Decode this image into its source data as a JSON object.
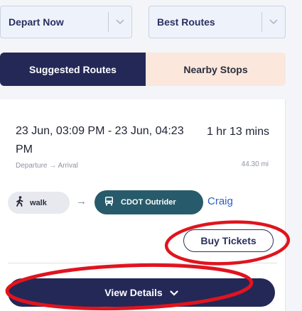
{
  "filters": {
    "departure_select": "Depart Now",
    "route_select": "Best Routes"
  },
  "tabs": [
    {
      "label": "Suggested Routes",
      "active": true
    },
    {
      "label": "Nearby Stops",
      "active": false
    }
  ],
  "route": {
    "time_range": "23 Jun, 03:09 PM - 23 Jun, 04:23 PM",
    "duration": "1 hr 13 mins",
    "dep_arr_label": "Departure → Arrival",
    "distance": "44.30 mi",
    "walk_label": "walk",
    "arrow": "→",
    "bus_label": "CDOT Outrider",
    "bus_link": "Craig",
    "buy_button": "Buy Tickets",
    "details_button": "View Details"
  },
  "colors": {
    "navy": "#232857",
    "teal": "#275b6b",
    "peach": "#fbe7dc",
    "link": "#2f5fc1",
    "annotation_red": "#e0141e"
  },
  "icons": {
    "select_chevron": "chevron-down-icon",
    "walk": "walk-icon",
    "bus": "bus-icon",
    "details_chevron": "chevron-down-icon"
  }
}
